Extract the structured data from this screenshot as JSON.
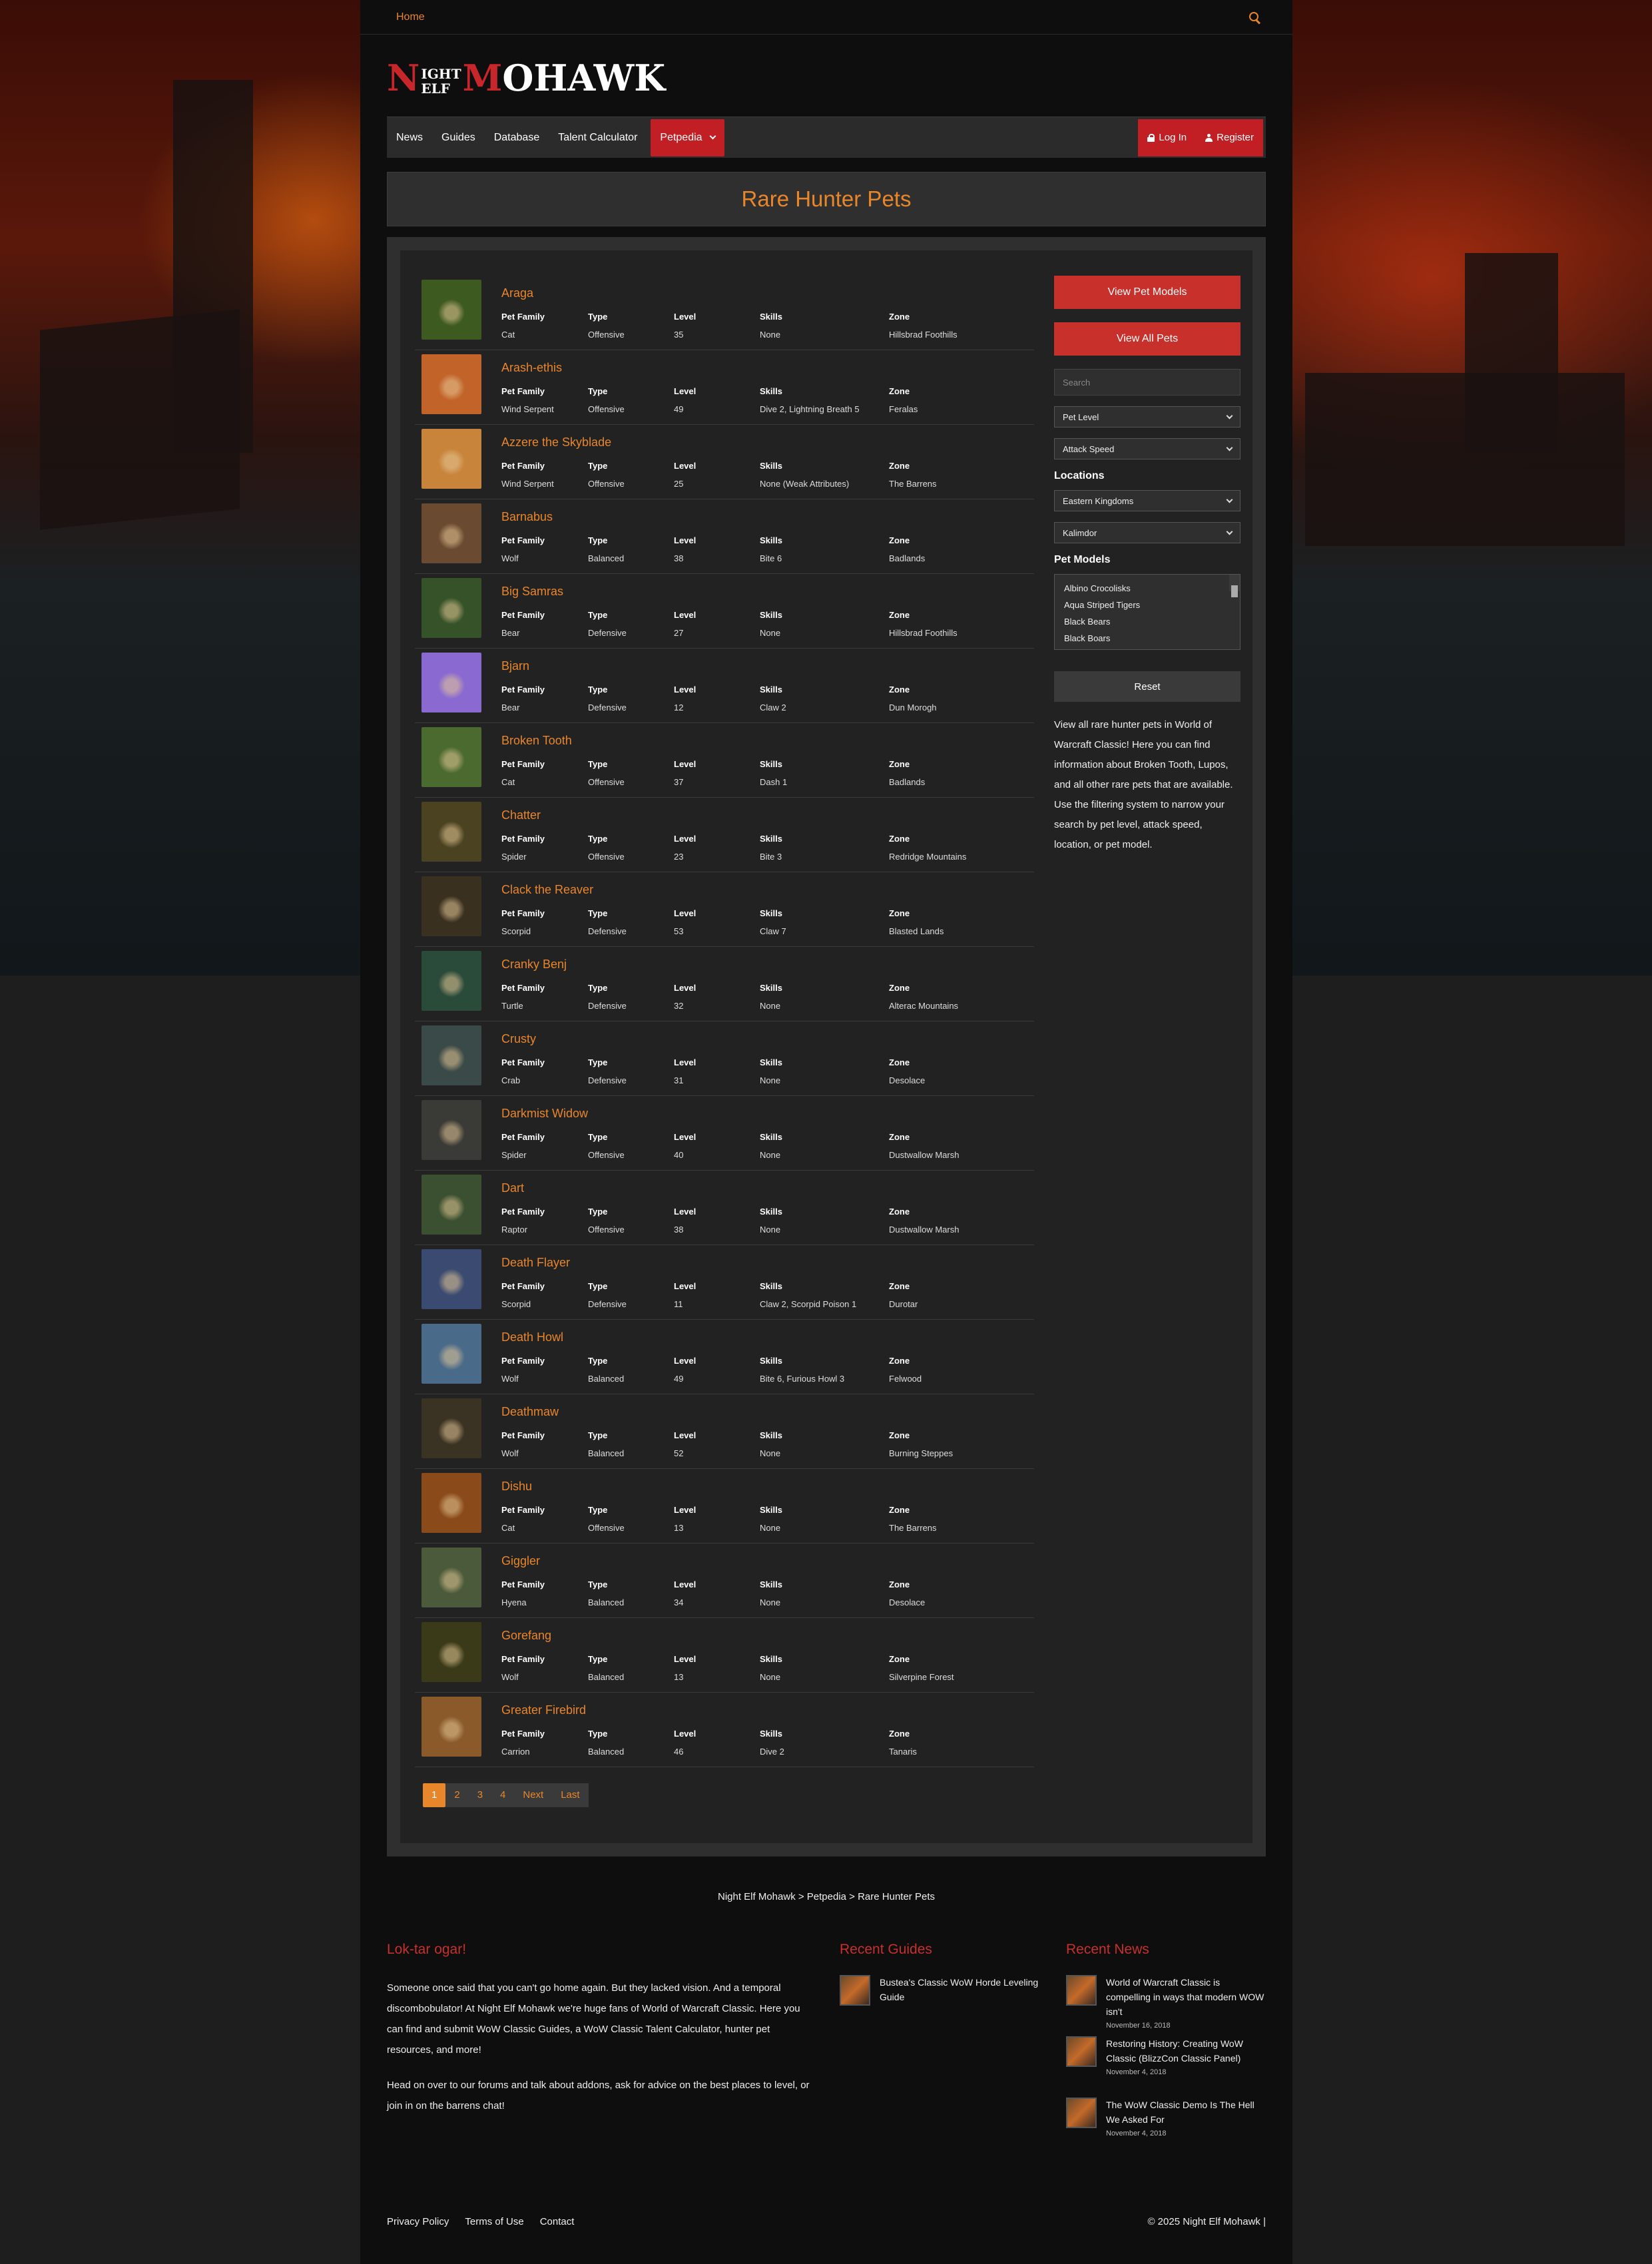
{
  "top": {
    "home": "Home"
  },
  "logo": {
    "n": "N",
    "ight": "IGHT",
    "elf": "ELF",
    "m": "M",
    "ohawk": "OHAWK"
  },
  "nav": {
    "items": [
      "News",
      "Guides",
      "Database",
      "Talent Calculator"
    ],
    "active": "Petpedia",
    "login": "Log In",
    "register": "Register"
  },
  "page_title": "Rare Hunter Pets",
  "headers": {
    "family": "Pet Family",
    "type": "Type",
    "level": "Level",
    "skills": "Skills",
    "zone": "Zone"
  },
  "pets": [
    {
      "name": "Araga",
      "family": "Cat",
      "type": "Offensive",
      "level": "35",
      "skills": "None",
      "zone": "Hillsbrad Foothills",
      "color": "#3d5a20"
    },
    {
      "name": "Arash-ethis",
      "family": "Wind Serpent",
      "type": "Offensive",
      "level": "49",
      "skills": "Dive 2, Lightning Breath 5",
      "zone": "Feralas",
      "color": "#c2642a"
    },
    {
      "name": "Azzere the Skyblade",
      "family": "Wind Serpent",
      "type": "Offensive",
      "level": "25",
      "skills": "None (Weak Attributes)",
      "zone": "The Barrens",
      "color": "#c8843a"
    },
    {
      "name": "Barnabus",
      "family": "Wolf",
      "type": "Balanced",
      "level": "38",
      "skills": "Bite 6",
      "zone": "Badlands",
      "color": "#6a4a30"
    },
    {
      "name": "Big Samras",
      "family": "Bear",
      "type": "Defensive",
      "level": "27",
      "skills": "None",
      "zone": "Hillsbrad Foothills",
      "color": "#355228"
    },
    {
      "name": "Bjarn",
      "family": "Bear",
      "type": "Defensive",
      "level": "12",
      "skills": "Claw 2",
      "zone": "Dun Morogh",
      "color": "#8a6ad0"
    },
    {
      "name": "Broken Tooth",
      "family": "Cat",
      "type": "Offensive",
      "level": "37",
      "skills": "Dash 1",
      "zone": "Badlands",
      "color": "#4a6a30"
    },
    {
      "name": "Chatter",
      "family": "Spider",
      "type": "Offensive",
      "level": "23",
      "skills": "Bite 3",
      "zone": "Redridge Mountains",
      "color": "#4a4220"
    },
    {
      "name": "Clack the Reaver",
      "family": "Scorpid",
      "type": "Defensive",
      "level": "53",
      "skills": "Claw 7",
      "zone": "Blasted Lands",
      "color": "#3a3020"
    },
    {
      "name": "Cranky Benj",
      "family": "Turtle",
      "type": "Defensive",
      "level": "32",
      "skills": "None",
      "zone": "Alterac Mountains",
      "color": "#2a4a3a"
    },
    {
      "name": "Crusty",
      "family": "Crab",
      "type": "Defensive",
      "level": "31",
      "skills": "None",
      "zone": "Desolace",
      "color": "#3a4a48"
    },
    {
      "name": "Darkmist Widow",
      "family": "Spider",
      "type": "Offensive",
      "level": "40",
      "skills": "None",
      "zone": "Dustwallow Marsh",
      "color": "#3a3a36"
    },
    {
      "name": "Dart",
      "family": "Raptor",
      "type": "Offensive",
      "level": "38",
      "skills": "None",
      "zone": "Dustwallow Marsh",
      "color": "#3a5030"
    },
    {
      "name": "Death Flayer",
      "family": "Scorpid",
      "type": "Defensive",
      "level": "11",
      "skills": "Claw 2, Scorpid Poison 1",
      "zone": "Durotar",
      "color": "#3a4a70"
    },
    {
      "name": "Death Howl",
      "family": "Wolf",
      "type": "Balanced",
      "level": "49",
      "skills": "Bite 6, Furious Howl 3",
      "zone": "Felwood",
      "color": "#4a6a8a"
    },
    {
      "name": "Deathmaw",
      "family": "Wolf",
      "type": "Balanced",
      "level": "52",
      "skills": "None",
      "zone": "Burning Steppes",
      "color": "#3a3222"
    },
    {
      "name": "Dishu",
      "family": "Cat",
      "type": "Offensive",
      "level": "13",
      "skills": "None",
      "zone": "The Barrens",
      "color": "#8a4a1a"
    },
    {
      "name": "Giggler",
      "family": "Hyena",
      "type": "Balanced",
      "level": "34",
      "skills": "None",
      "zone": "Desolace",
      "color": "#4a5a3a"
    },
    {
      "name": "Gorefang",
      "family": "Wolf",
      "type": "Balanced",
      "level": "13",
      "skills": "None",
      "zone": "Silverpine Forest",
      "color": "#3a3a18"
    },
    {
      "name": "Greater Firebird",
      "family": "Carrion",
      "type": "Balanced",
      "level": "46",
      "skills": "Dive 2",
      "zone": "Tanaris",
      "color": "#8a5a2a"
    }
  ],
  "pager": [
    "1",
    "2",
    "3",
    "4",
    "Next",
    "Last"
  ],
  "sidebar": {
    "view_models": "View Pet Models",
    "view_all": "View All Pets",
    "search_placeholder": "Search",
    "pet_level": "Pet Level",
    "attack_speed": "Attack Speed",
    "locations_title": "Locations",
    "loc1": "Eastern Kingdoms",
    "loc2": "Kalimdor",
    "models_title": "Pet Models",
    "models": [
      "Albino Crocolisks",
      "Aqua Striped Tigers",
      "Black Bears",
      "Black Boars"
    ],
    "reset": "Reset",
    "description": "View all rare hunter pets in World of Warcraft Classic! Here you can find information about Broken Tooth, Lupos, and all other rare pets that are available. Use the filtering system to narrow your search by pet level, attack speed, location, or pet model."
  },
  "breadcrumb": "Night Elf Mohawk > Petpedia > Rare Hunter Pets",
  "footer": {
    "about_title": "Lok-tar ogar!",
    "about_p1": "Someone once said that you can't go home again. But they lacked vision. And a temporal discombobulator! At Night Elf Mohawk we're huge fans of World of Warcraft Classic. Here you can find and submit WoW Classic Guides, a WoW Classic Talent Calculator, hunter pet resources, and more!",
    "about_p2": "Head on over to our forums and talk about addons, ask for advice on the best places to level, or join in on the barrens chat!",
    "guides_title": "Recent Guides",
    "guide1": "Bustea's Classic WoW Horde Leveling Guide",
    "news_title": "Recent News",
    "news": [
      {
        "title": "World of Warcraft Classic is compelling in ways that modern WOW isn't",
        "date": "November 16, 2018"
      },
      {
        "title": "Restoring History: Creating WoW Classic (BlizzCon Classic Panel)",
        "date": "November 4, 2018"
      },
      {
        "title": "The WoW Classic Demo Is The Hell We Asked For",
        "date": "November 4, 2018"
      }
    ],
    "links": [
      "Privacy Policy",
      "Terms of Use",
      "Contact"
    ],
    "copyright": "© 2025 Night Elf Mohawk |"
  }
}
